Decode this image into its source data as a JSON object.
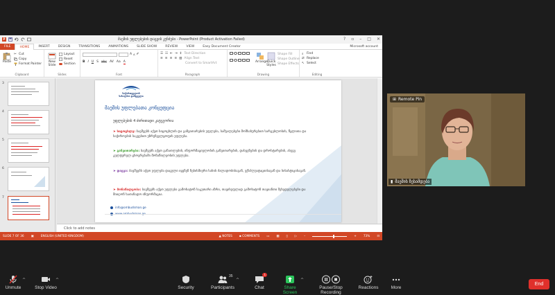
{
  "ppt": {
    "title": "მაეშის უფლებების დაცვის კუნძები - PowerPoint (Product Activation Failed)",
    "tabs": [
      "FILE",
      "HOME",
      "INSERT",
      "DESIGN",
      "TRANSITIONS",
      "ANIMATIONS",
      "SLIDE SHOW",
      "REVIEW",
      "VIEW",
      "Easy Document Creator"
    ],
    "account": "Microsoft account",
    "ribbon": {
      "clipboard": {
        "paste": "Paste",
        "cut": "Cut",
        "copy": "Copy",
        "format_painter": "Format Painter",
        "label": "Clipboard"
      },
      "slides": {
        "new_slide": "New Slide",
        "layout": "Layout",
        "reset": "Reset",
        "section": "Section",
        "label": "Slides"
      },
      "font": {
        "label": "Font",
        "bold": "B",
        "italic": "I",
        "underline": "U",
        "shadow": "S",
        "strike": "abc",
        "spacing": "AV",
        "case": "Aa",
        "color": "A"
      },
      "paragraph": {
        "text_direction": "Text Direction",
        "align_text": "Align Text",
        "convert_smartart": "Convert to SmartArt",
        "label": "Paragraph"
      },
      "drawing": {
        "arrange": "Arrange",
        "quick_styles": "Quick Styles",
        "shape_fill": "Shape Fill",
        "shape_outline": "Shape Outline",
        "shape_effects": "Shape Effects",
        "label": "Drawing"
      },
      "editing": {
        "find": "Find",
        "replace": "Replace",
        "select": "Select",
        "label": "Editing"
      }
    },
    "thumbs": [
      {
        "num": "3"
      },
      {
        "num": "4"
      },
      {
        "num": "5"
      },
      {
        "num": "6"
      },
      {
        "num": "7"
      }
    ],
    "slide": {
      "logo_line1": "საქართველოს",
      "logo_line2": "სახალხო დამცველი",
      "title": "მაეშის უფლებათა კონცეფცია",
      "subtitle": "უფლებების 4 ძირითადი კატეგორია",
      "bullets": [
        {
          "kw": "სიცოცხლე:",
          "text": " ბავშვებს აქვთ სიცოცხლის და განვითარების უფლება, საშუალებები მომსახურებით სარგებლობის, წყლითა და საჭიროების საკვებით უზრუნველყოფის უფლება.",
          "color": "#d72b2b",
          "arrow_color": "#d72b2b"
        },
        {
          "kw": "განვითარება:",
          "text": " ბავშვებს აქვთ განათლების, ინფორმაციულობის განვითარების, დასვენების და დროსტარების, ასევე კულტურულ ცხოვრებაში მონაწილეობის უფლება.",
          "color": "#3a9a2a",
          "arrow_color": "#3a9a2a"
        },
        {
          "kw": "დაცვა:",
          "text": " ბავშვებს აქვთ უფლება დაცული იყვნენ ნებისმიერი სახის ძალადობისაგან, ექსპლუატაციისაგან და სისასტიკისაგან.",
          "color": "#7b3aa0",
          "arrow_color": "#7b3aa0"
        },
        {
          "kw": "მონაწილეობა:",
          "text": " ბავშვებს აქვთ უფლება გამოხატონ საკუთარი აზრი, თავისუფლად გამოხატონ თავიანთი შეხედულებები და მიიღონ სათანადო ინფორმაცია.",
          "color": "#d72b2b",
          "arrow_color": "#d72b2b"
        }
      ],
      "email": "info@ombudsman.ge",
      "web": "www.ombudsman.ge"
    },
    "notes_placeholder": "Click to add notes",
    "status": {
      "slide_num": "SLIDE 7 OF 36",
      "language": "ENGLISH (UNITED KINGDOM)",
      "notes": "NOTES",
      "comments": "COMMENTS",
      "zoom": "73%"
    }
  },
  "video": {
    "remote_label": "Remote Pin",
    "participant_name": "მაეშის ზესამდება"
  },
  "zoom_toolbar": {
    "unmute": "Unmute",
    "stop_video": "Stop Video",
    "security": "Security",
    "participants": "Participants",
    "participants_count": "35",
    "chat": "Chat",
    "chat_badge": "1",
    "share_screen": "Share Screen",
    "pause_recording": "Pause/Stop Recording",
    "reactions": "Reactions",
    "more": "More",
    "end": "End"
  },
  "colors": {
    "ppt_accent": "#d24726",
    "zoom_bg": "#1c1c1c",
    "end_red": "#e0302b",
    "share_green": "#2bc45b",
    "slide_blue": "#1a4f9c"
  }
}
